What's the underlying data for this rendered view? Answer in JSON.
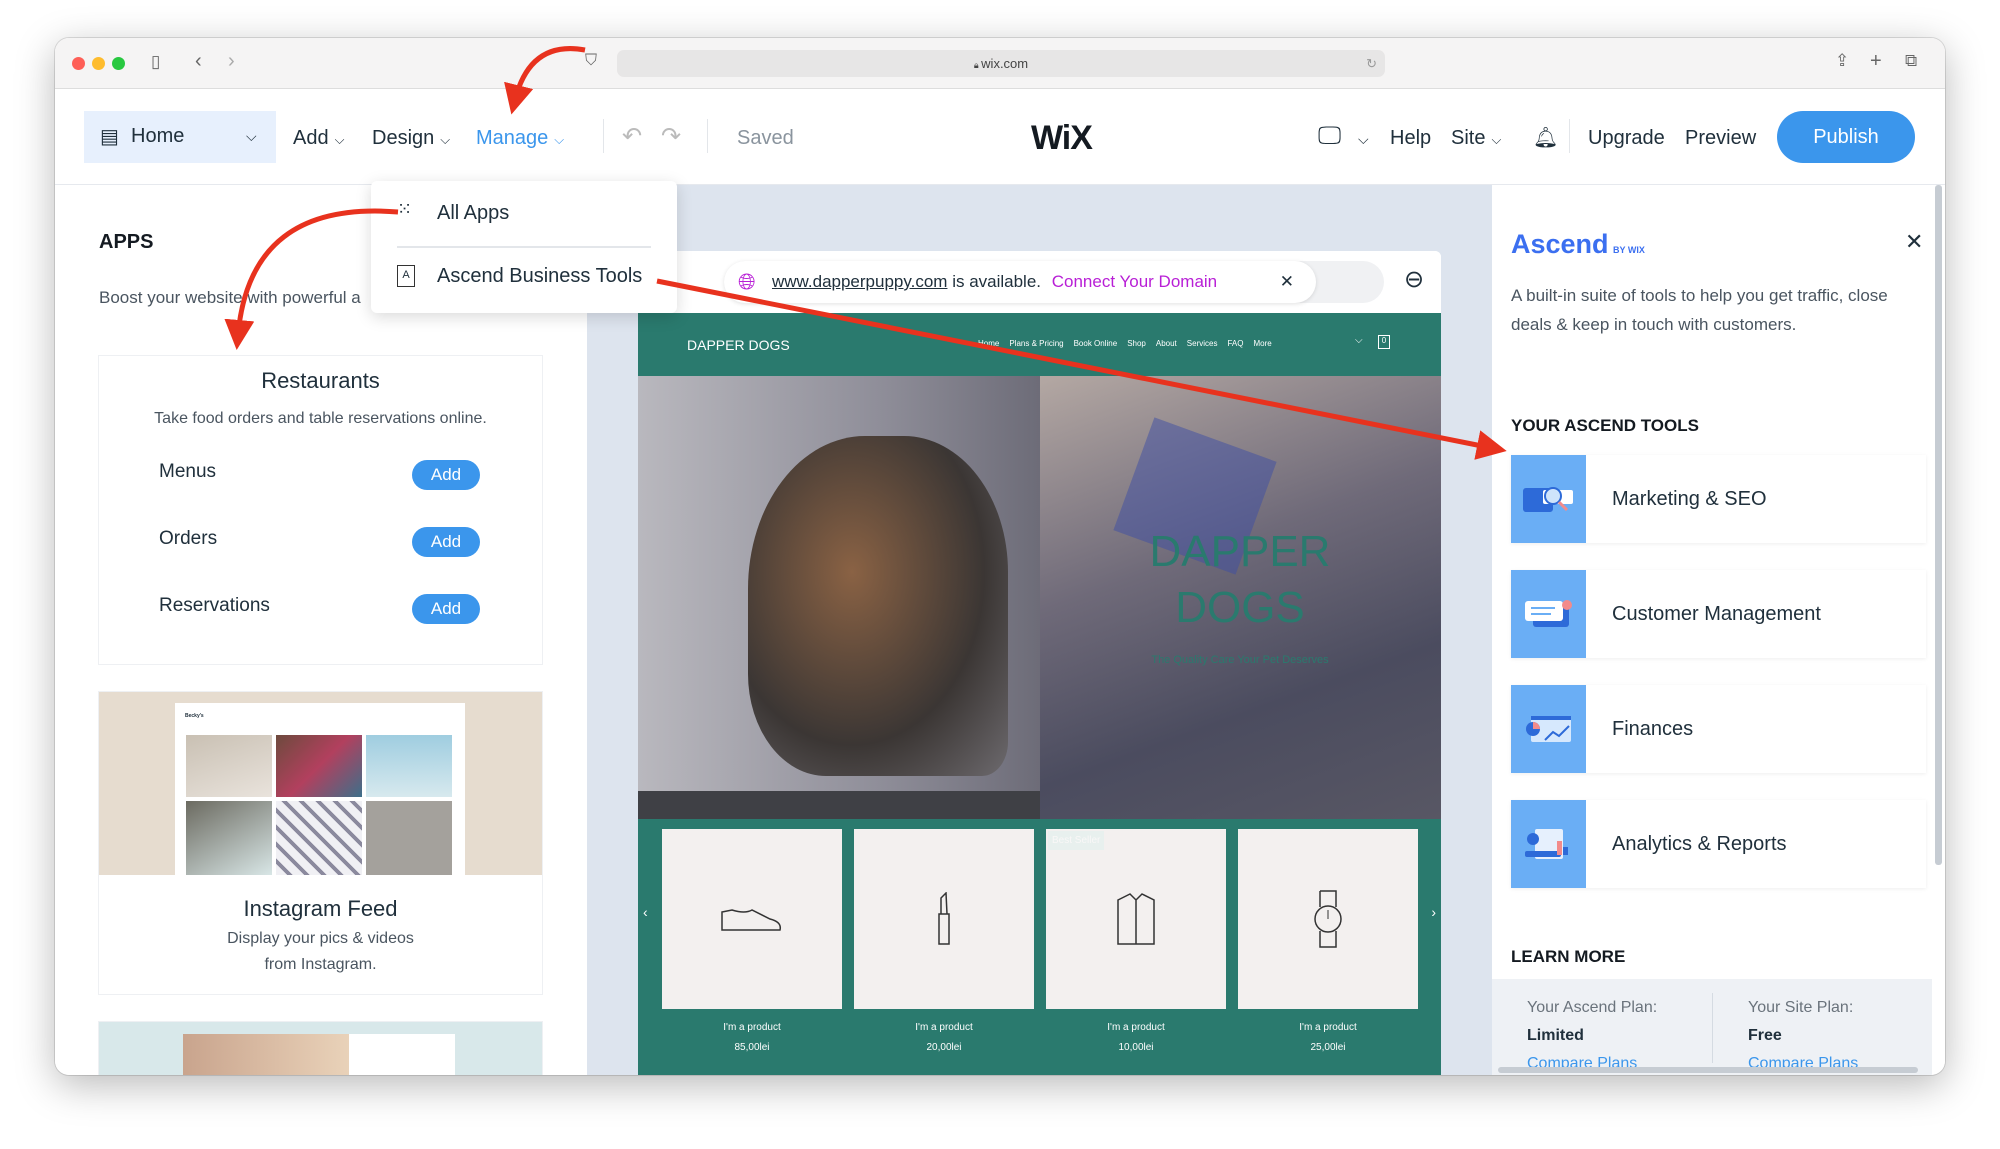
{
  "browser": {
    "url": "wix.com"
  },
  "toolbar": {
    "page": "Home",
    "add": "Add",
    "design": "Design",
    "manage": "Manage",
    "saved": "Saved",
    "logo": "WiX",
    "help": "Help",
    "site": "Site",
    "upgrade": "Upgrade",
    "preview": "Preview",
    "publish": "Publish"
  },
  "manage_menu": {
    "items": [
      {
        "label": "All Apps",
        "icon": "grid-icon"
      },
      {
        "label": "Ascend Business Tools",
        "icon": "ascend-icon"
      }
    ]
  },
  "apps_panel": {
    "title": "APPS",
    "subtitle": "Boost your website with powerful a",
    "restaurants": {
      "title": "Restaurants",
      "desc": "Take food orders and table reservations online.",
      "items": [
        {
          "label": "Menus",
          "button": "Add"
        },
        {
          "label": "Orders",
          "button": "Add"
        },
        {
          "label": "Reservations",
          "button": "Add"
        }
      ]
    },
    "instagram": {
      "title": "Instagram Feed",
      "desc1": "Display your pics & videos",
      "desc2": "from Instagram.",
      "preview_brand": "Becky's"
    }
  },
  "site_preview": {
    "domain": "www.dapperpuppy.com",
    "available": "is available.",
    "connect": "Connect Your Domain",
    "brand": "DAPPER DOGS",
    "nav": [
      "Home",
      "Plans & Pricing",
      "Book Online",
      "Shop",
      "About",
      "Services",
      "FAQ",
      "More"
    ],
    "cart_count": "0",
    "hero_title1": "DAPPER",
    "hero_title2": "DOGS",
    "hero_tagline": "The Quality Care Your Pet Deserves",
    "badge": "Best Seller",
    "products": [
      {
        "name": "I'm a product",
        "price": "85,00lei",
        "icon": "shoe-icon"
      },
      {
        "name": "I'm a product",
        "price": "20,00lei",
        "icon": "lipstick-icon"
      },
      {
        "name": "I'm a product",
        "price": "10,00lei",
        "icon": "shirt-icon"
      },
      {
        "name": "I'm a product",
        "price": "25,00lei",
        "icon": "watch-icon"
      }
    ]
  },
  "ascend": {
    "logo": "Ascend",
    "logo_by": "BY WIX",
    "desc": "A built-in suite of tools to help you get traffic, close deals & keep in touch with customers.",
    "tools_title": "YOUR ASCEND TOOLS",
    "tools": [
      {
        "label": "Marketing & SEO"
      },
      {
        "label": "Customer Management"
      },
      {
        "label": "Finances"
      },
      {
        "label": "Analytics & Reports"
      }
    ],
    "learn_more": "LEARN MORE",
    "plans": [
      {
        "label": "Your Ascend Plan:",
        "value": "Limited",
        "link": "Compare Plans"
      },
      {
        "label": "Your Site Plan:",
        "value": "Free",
        "link": "Compare Plans"
      }
    ]
  },
  "colors": {
    "accent": "#3b96ec",
    "site_green": "#2a7a6e",
    "annotation": "#e8321e",
    "domain_link": "#b81fd6"
  }
}
